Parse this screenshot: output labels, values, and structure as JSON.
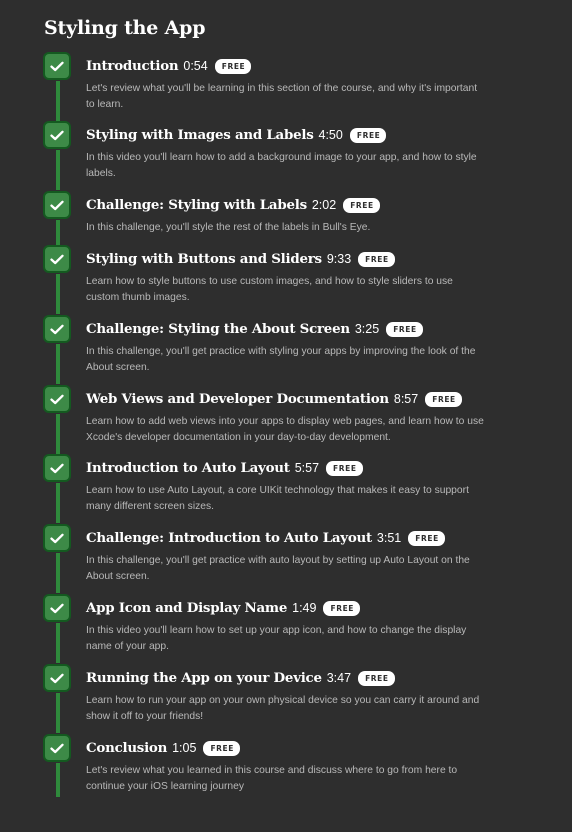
{
  "section": {
    "title": "Styling the App"
  },
  "colors": {
    "background": "#2e2e2e",
    "check_fill": "#3d8a47",
    "check_border": "#145a20",
    "connector": "#2f8a3c",
    "badge_bg": "#ffffff",
    "description_text": "#b9b9b9"
  },
  "lessons": [
    {
      "title": "Introduction",
      "duration": "0:54",
      "badge": "FREE",
      "description": "Let's review what you'll be learning in this section of the course, and why it's important to learn.",
      "completed": true
    },
    {
      "title": "Styling with Images and Labels",
      "duration": "4:50",
      "badge": "FREE",
      "description": "In this video you'll learn how to add a background image to your app, and how to style labels.",
      "completed": true
    },
    {
      "title": "Challenge: Styling with Labels",
      "duration": "2:02",
      "badge": "FREE",
      "description": "In this challenge, you'll style the rest of the labels in Bull's Eye.",
      "completed": true
    },
    {
      "title": "Styling with Buttons and Sliders",
      "duration": "9:33",
      "badge": "FREE",
      "description": "Learn how to style buttons to use custom images, and how to style sliders to use custom thumb images.",
      "completed": true
    },
    {
      "title": "Challenge: Styling the About Screen",
      "duration": "3:25",
      "badge": "FREE",
      "description": "In this challenge, you'll get practice with styling your apps by improving the look of the About screen.",
      "completed": true
    },
    {
      "title": "Web Views and Developer Documentation",
      "duration": "8:57",
      "badge": "FREE",
      "description": "Learn how to add web views into your apps to display web pages, and learn how to use Xcode's developer documentation in your day-to-day development.",
      "completed": true
    },
    {
      "title": "Introduction to Auto Layout",
      "duration": "5:57",
      "badge": "FREE",
      "description": "Learn how to use Auto Layout, a core UIKit technology that makes it easy to support many different screen sizes.",
      "completed": true
    },
    {
      "title": "Challenge: Introduction to Auto Layout",
      "duration": "3:51",
      "badge": "FREE",
      "description": "In this challenge, you'll get practice with auto layout by setting up Auto Layout on the About screen.",
      "completed": true
    },
    {
      "title": "App Icon and Display Name",
      "duration": "1:49",
      "badge": "FREE",
      "description": "In this video you'll learn how to set up your app icon, and how to change the display name of your app.",
      "completed": true
    },
    {
      "title": "Running the App on your Device",
      "duration": "3:47",
      "badge": "FREE",
      "description": "Learn how to run your app on your own physical device so you can carry it around and show it off to your friends!",
      "completed": true
    },
    {
      "title": "Conclusion",
      "duration": "1:05",
      "badge": "FREE",
      "description": "Let's review what you learned in this course and discuss where to go from here to continue your iOS learning journey",
      "completed": true
    }
  ]
}
